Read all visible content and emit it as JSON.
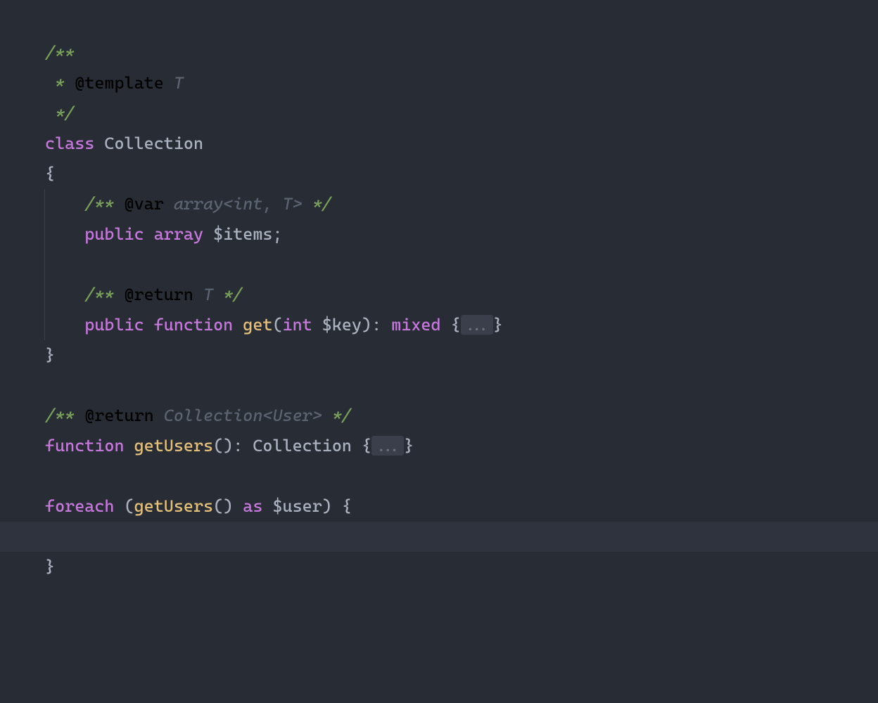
{
  "colors": {
    "background": "#282c34",
    "line_highlight": "#2f333d",
    "comment": "#5b6370",
    "doc": "#79a05a",
    "keyword": "#c678dd",
    "func": "#e5c07b",
    "text": "#abb2bf",
    "fold_bg": "#3a3f4b"
  },
  "highlighted_line_index": 16,
  "code_lines": [
    {
      "i": 0,
      "indent": 0,
      "tokens": [
        {
          "t": "doc-delim",
          "v": "/**"
        }
      ]
    },
    {
      "i": 1,
      "indent": 0,
      "tokens": [
        {
          "t": "doc-star",
          "v": " * "
        },
        {
          "t": "doc-tag",
          "v": "@template"
        },
        {
          "t": "doc-type",
          "v": " T"
        }
      ]
    },
    {
      "i": 2,
      "indent": 0,
      "tokens": [
        {
          "t": "doc-delim",
          "v": " */"
        }
      ]
    },
    {
      "i": 3,
      "indent": 0,
      "tokens": [
        {
          "t": "keyword",
          "v": "class"
        },
        {
          "t": "plain",
          "v": " "
        },
        {
          "t": "classname",
          "v": "Collection"
        }
      ]
    },
    {
      "i": 4,
      "indent": 0,
      "tokens": [
        {
          "t": "punc",
          "v": "{"
        }
      ]
    },
    {
      "i": 5,
      "indent": 1,
      "tokens": [
        {
          "t": "doc-delim",
          "v": "/** "
        },
        {
          "t": "doc-tag",
          "v": "@var"
        },
        {
          "t": "doc-type",
          "v": " array<int, T>"
        },
        {
          "t": "doc-delim",
          "v": " */"
        }
      ]
    },
    {
      "i": 6,
      "indent": 1,
      "tokens": [
        {
          "t": "keyword",
          "v": "public"
        },
        {
          "t": "plain",
          "v": " "
        },
        {
          "t": "keyword",
          "v": "array"
        },
        {
          "t": "plain",
          "v": " "
        },
        {
          "t": "var",
          "v": "$items"
        },
        {
          "t": "punc",
          "v": ";"
        }
      ]
    },
    {
      "i": 7,
      "indent": 1,
      "blank": true,
      "tokens": []
    },
    {
      "i": 8,
      "indent": 1,
      "tokens": [
        {
          "t": "doc-delim",
          "v": "/** "
        },
        {
          "t": "doc-tag",
          "v": "@return"
        },
        {
          "t": "doc-type",
          "v": " T"
        },
        {
          "t": "doc-delim",
          "v": " */"
        }
      ]
    },
    {
      "i": 9,
      "indent": 1,
      "tokens": [
        {
          "t": "keyword",
          "v": "public"
        },
        {
          "t": "plain",
          "v": " "
        },
        {
          "t": "keyword",
          "v": "function"
        },
        {
          "t": "plain",
          "v": " "
        },
        {
          "t": "func",
          "v": "get"
        },
        {
          "t": "punc",
          "v": "("
        },
        {
          "t": "keyword",
          "v": "int"
        },
        {
          "t": "plain",
          "v": " "
        },
        {
          "t": "var",
          "v": "$key"
        },
        {
          "t": "punc",
          "v": "): "
        },
        {
          "t": "keyword",
          "v": "mixed"
        },
        {
          "t": "plain",
          "v": " "
        },
        {
          "t": "punc",
          "v": "{"
        },
        {
          "t": "fold",
          "v": "..."
        },
        {
          "t": "punc",
          "v": "}"
        }
      ]
    },
    {
      "i": 10,
      "indent": 0,
      "tokens": [
        {
          "t": "punc",
          "v": "}"
        }
      ]
    },
    {
      "i": 11,
      "indent": 0,
      "blank": true,
      "tokens": []
    },
    {
      "i": 12,
      "indent": 0,
      "tokens": [
        {
          "t": "doc-delim",
          "v": "/** "
        },
        {
          "t": "doc-tag",
          "v": "@return"
        },
        {
          "t": "doc-type",
          "v": " Collection<User>"
        },
        {
          "t": "doc-delim",
          "v": " */"
        }
      ]
    },
    {
      "i": 13,
      "indent": 0,
      "tokens": [
        {
          "t": "keyword",
          "v": "function"
        },
        {
          "t": "plain",
          "v": " "
        },
        {
          "t": "func",
          "v": "getUsers"
        },
        {
          "t": "punc",
          "v": "(): "
        },
        {
          "t": "classuse",
          "v": "Collection"
        },
        {
          "t": "plain",
          "v": " "
        },
        {
          "t": "punc",
          "v": "{"
        },
        {
          "t": "fold",
          "v": "..."
        },
        {
          "t": "punc",
          "v": "}"
        }
      ]
    },
    {
      "i": 14,
      "indent": 0,
      "blank": true,
      "tokens": []
    },
    {
      "i": 15,
      "indent": 0,
      "tokens": [
        {
          "t": "keyword",
          "v": "foreach"
        },
        {
          "t": "plain",
          "v": " "
        },
        {
          "t": "punc",
          "v": "("
        },
        {
          "t": "func",
          "v": "getUsers"
        },
        {
          "t": "punc",
          "v": "() "
        },
        {
          "t": "keyword",
          "v": "as"
        },
        {
          "t": "plain",
          "v": " "
        },
        {
          "t": "var",
          "v": "$user"
        },
        {
          "t": "punc",
          "v": ") {"
        }
      ]
    },
    {
      "i": 16,
      "indent": 1,
      "blank": true,
      "tokens": []
    },
    {
      "i": 17,
      "indent": 0,
      "tokens": [
        {
          "t": "punc",
          "v": "}"
        }
      ]
    }
  ]
}
